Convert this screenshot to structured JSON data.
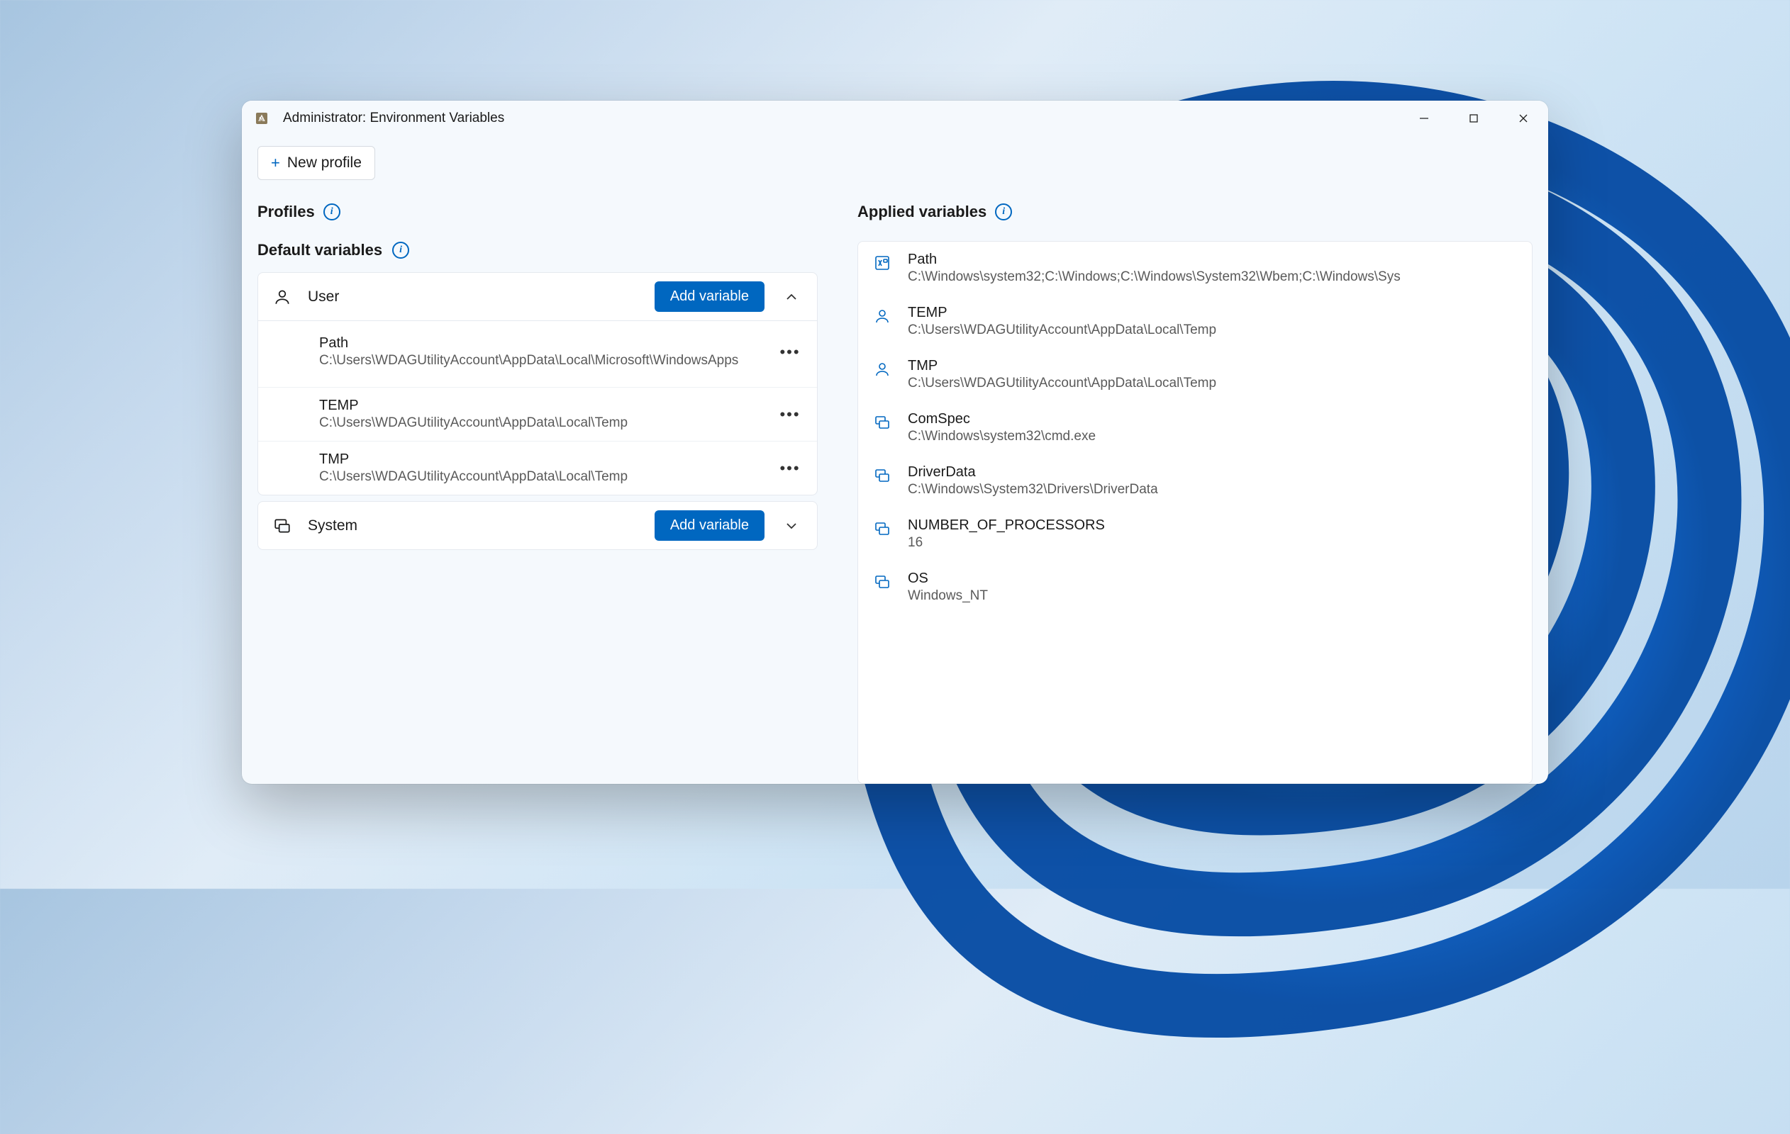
{
  "window": {
    "title": "Administrator: Environment Variables"
  },
  "toolbar": {
    "new_profile_label": "New profile"
  },
  "profiles_section": {
    "title": "Profiles"
  },
  "default_vars_section": {
    "title": "Default variables"
  },
  "user_card": {
    "label": "User",
    "add_label": "Add variable",
    "vars": [
      {
        "name": "Path",
        "value": "C:\\Users\\WDAGUtilityAccount\\AppData\\Local\\Microsoft\\WindowsApps"
      },
      {
        "name": "TEMP",
        "value": "C:\\Users\\WDAGUtilityAccount\\AppData\\Local\\Temp"
      },
      {
        "name": "TMP",
        "value": "C:\\Users\\WDAGUtilityAccount\\AppData\\Local\\Temp"
      }
    ]
  },
  "system_card": {
    "label": "System",
    "add_label": "Add variable"
  },
  "applied_section": {
    "title": "Applied variables",
    "vars": [
      {
        "icon": "app",
        "name": "Path",
        "value": "C:\\Windows\\system32;C:\\Windows;C:\\Windows\\System32\\Wbem;C:\\Windows\\Sys"
      },
      {
        "icon": "user",
        "name": "TEMP",
        "value": "C:\\Users\\WDAGUtilityAccount\\AppData\\Local\\Temp"
      },
      {
        "icon": "user",
        "name": "TMP",
        "value": "C:\\Users\\WDAGUtilityAccount\\AppData\\Local\\Temp"
      },
      {
        "icon": "system",
        "name": "ComSpec",
        "value": "C:\\Windows\\system32\\cmd.exe"
      },
      {
        "icon": "system",
        "name": "DriverData",
        "value": "C:\\Windows\\System32\\Drivers\\DriverData"
      },
      {
        "icon": "system",
        "name": "NUMBER_OF_PROCESSORS",
        "value": "16"
      },
      {
        "icon": "system",
        "name": "OS",
        "value": "Windows_NT"
      }
    ]
  }
}
